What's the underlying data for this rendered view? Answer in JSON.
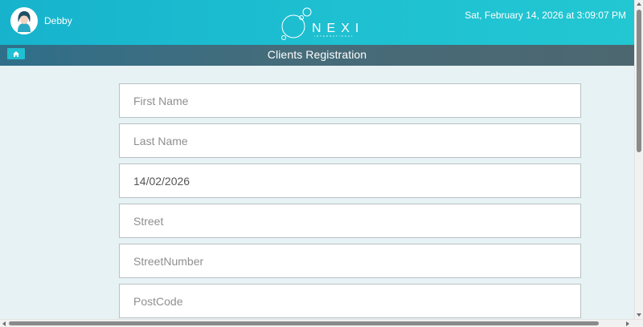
{
  "header": {
    "username": "Debby",
    "datetime": "Sat, February 14, 2026 at 3:09:07 PM",
    "logo": {
      "text": "NEXI",
      "subtext": "INTERNATIONAL",
      "icon": "bubbles-logo"
    }
  },
  "titlebar": {
    "title": "Clients Registration",
    "home_icon": "home-icon"
  },
  "form": {
    "first_name": {
      "placeholder": "First Name",
      "value": ""
    },
    "last_name": {
      "placeholder": "Last Name",
      "value": ""
    },
    "date": {
      "placeholder": "",
      "value": "14/02/2026"
    },
    "street": {
      "placeholder": "Street",
      "value": ""
    },
    "street_number": {
      "placeholder": "StreetNumber",
      "value": ""
    },
    "post_code": {
      "placeholder": "PostCode",
      "value": ""
    }
  },
  "colors": {
    "header_gradient_start": "#17b3cd",
    "header_gradient_end": "#22c7d2",
    "titlebar": "#456c7a",
    "accent": "#1ec0d1",
    "page_background": "#e6f2f3"
  }
}
